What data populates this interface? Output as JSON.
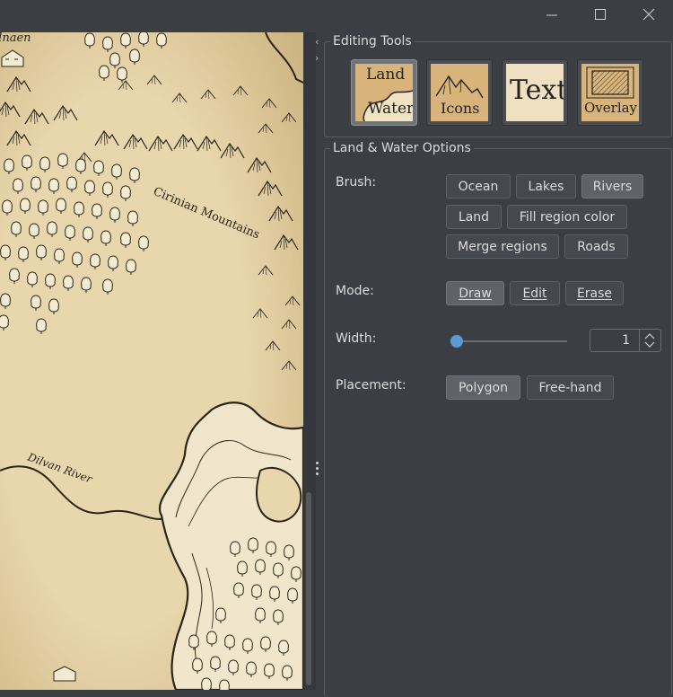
{
  "window": {
    "controls": {
      "minimize": "minimize-icon",
      "maximize": "maximize-icon",
      "close": "close-icon"
    }
  },
  "map": {
    "labels": {
      "top_fragment": "ilnaen",
      "mountains": "Cirinian Mountains",
      "river": "Dilvan River"
    },
    "colors": {
      "parchment": "#e6d3a7",
      "ink": "#2b2418",
      "light_land": "#f1e6cc"
    }
  },
  "editing_tools": {
    "title": "Editing Tools",
    "tools": [
      {
        "line1": "Land",
        "line2": "Water",
        "selected": true
      },
      {
        "line1": "Icons",
        "selected": false
      },
      {
        "line1": "Text",
        "selected": false
      },
      {
        "line1": "Overlay",
        "selected": false
      }
    ]
  },
  "options": {
    "title": "Land & Water Options",
    "brush": {
      "label": "Brush:",
      "buttons": [
        "Ocean",
        "Lakes",
        "Rivers",
        "Land",
        "Fill region color",
        "Merge regions",
        "Roads"
      ],
      "selected": "Rivers"
    },
    "mode": {
      "label": "Mode:",
      "buttons": [
        "Draw",
        "Edit",
        "Erase"
      ],
      "selected": "Draw"
    },
    "width": {
      "label": "Width:",
      "value": "1",
      "slider_fraction": 0
    },
    "placement": {
      "label": "Placement:",
      "buttons": [
        "Polygon",
        "Free-hand"
      ],
      "selected": "Polygon"
    }
  },
  "colors": {
    "panel_bg": "#3b3e43",
    "accent": "#5a9bd5",
    "button_bg": "#45484d",
    "button_active": "#5f6267"
  }
}
